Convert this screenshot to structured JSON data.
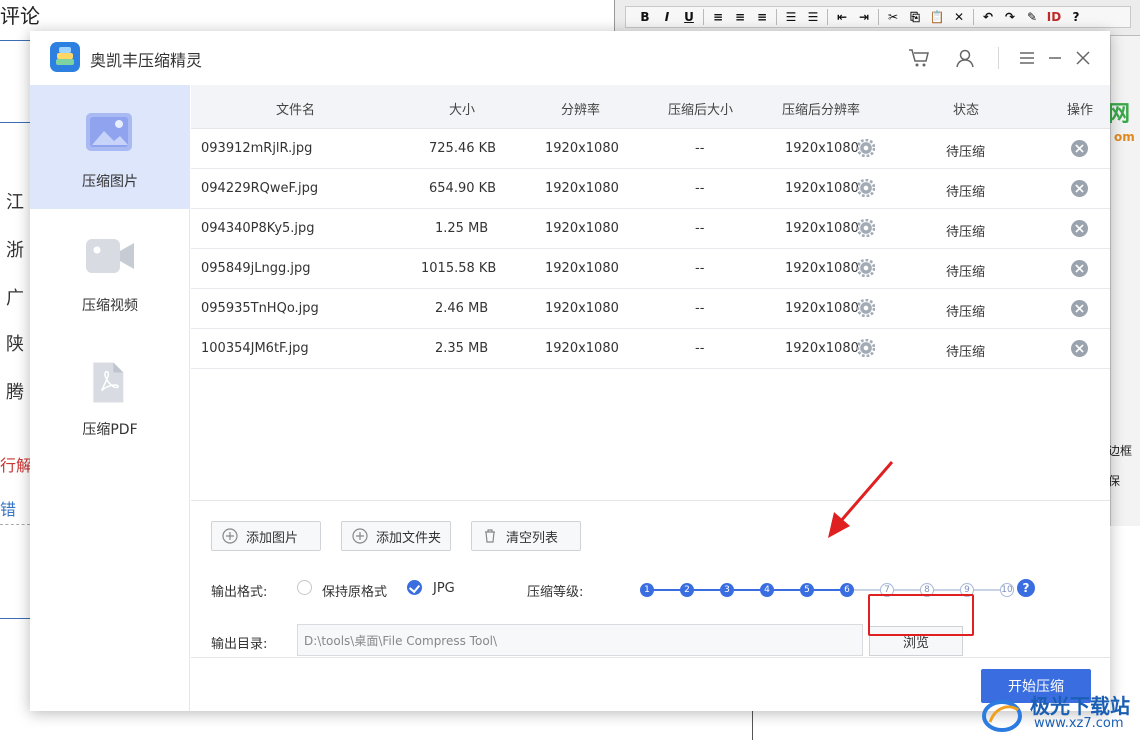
{
  "background": {
    "heading": "评论",
    "side_chars": [
      "江",
      "浙",
      "广",
      "陕",
      "腾"
    ],
    "red_text": "行解",
    "blue_text": "错",
    "right_text1": "边框",
    "right_text2": "保",
    "watermark_green": "网",
    "watermark_orange": "om",
    "toolbar_buttons": [
      "B",
      "I",
      "U",
      "≡",
      "≡",
      "≡",
      "☰",
      "☰",
      "⇤",
      "⇥",
      "✂",
      "⎘",
      "📋",
      "✕",
      "↶",
      "↷",
      "✎",
      "ID",
      "?"
    ]
  },
  "app": {
    "title": "奥凯丰压缩精灵"
  },
  "sidebar": {
    "items": [
      {
        "label": "压缩图片",
        "icon": "image-icon",
        "active": true
      },
      {
        "label": "压缩视频",
        "icon": "video-camera-icon",
        "active": false
      },
      {
        "label": "压缩PDF",
        "icon": "pdf-file-icon",
        "active": false
      }
    ]
  },
  "table": {
    "columns": [
      "文件名",
      "大小",
      "分辨率",
      "压缩后大小",
      "压缩后分辨率",
      "状态",
      "操作"
    ],
    "rows": [
      {
        "name": "093912mRjlR.jpg",
        "size": "725.46 KB",
        "resolution": "1920x1080",
        "compressed_size": "--",
        "compressed_resolution": "1920x1080",
        "status": "待压缩"
      },
      {
        "name": "094229RQweF.jpg",
        "size": "654.90 KB",
        "resolution": "1920x1080",
        "compressed_size": "--",
        "compressed_resolution": "1920x1080",
        "status": "待压缩"
      },
      {
        "name": "094340P8Ky5.jpg",
        "size": "1.25 MB",
        "resolution": "1920x1080",
        "compressed_size": "--",
        "compressed_resolution": "1920x1080",
        "status": "待压缩"
      },
      {
        "name": "095849jLngg.jpg",
        "size": "1015.58 KB",
        "resolution": "1920x1080",
        "compressed_size": "--",
        "compressed_resolution": "1920x1080",
        "status": "待压缩"
      },
      {
        "name": "095935TnHQo.jpg",
        "size": "2.46 MB",
        "resolution": "1920x1080",
        "compressed_size": "--",
        "compressed_resolution": "1920x1080",
        "status": "待压缩"
      },
      {
        "name": "100354JM6tF.jpg",
        "size": "2.35 MB",
        "resolution": "1920x1080",
        "compressed_size": "--",
        "compressed_resolution": "1920x1080",
        "status": "待压缩"
      }
    ]
  },
  "actions": {
    "add_image": "添加图片",
    "add_folder": "添加文件夹",
    "clear_list": "清空列表"
  },
  "output": {
    "format_label": "输出格式:",
    "format_options": [
      {
        "label": "保持原格式",
        "selected": false
      },
      {
        "label": "JPG",
        "selected": true
      }
    ],
    "level_label": "压缩等级:",
    "levels": [
      "1",
      "2",
      "3",
      "4",
      "5",
      "6",
      "7",
      "8",
      "9",
      "10"
    ],
    "selected_level": 6,
    "dir_label": "输出目录:",
    "dir_value": "D:\\tools\\桌面\\File Compress Tool\\",
    "browse": "浏览"
  },
  "footer": {
    "start": "开始压缩"
  },
  "watermark": {
    "name": "极光下载站",
    "url": "www.xz7.com"
  },
  "colors": {
    "accent": "#3a6ee0",
    "sidebar_active": "#dde6fb",
    "highlight_red": "#e02020"
  }
}
